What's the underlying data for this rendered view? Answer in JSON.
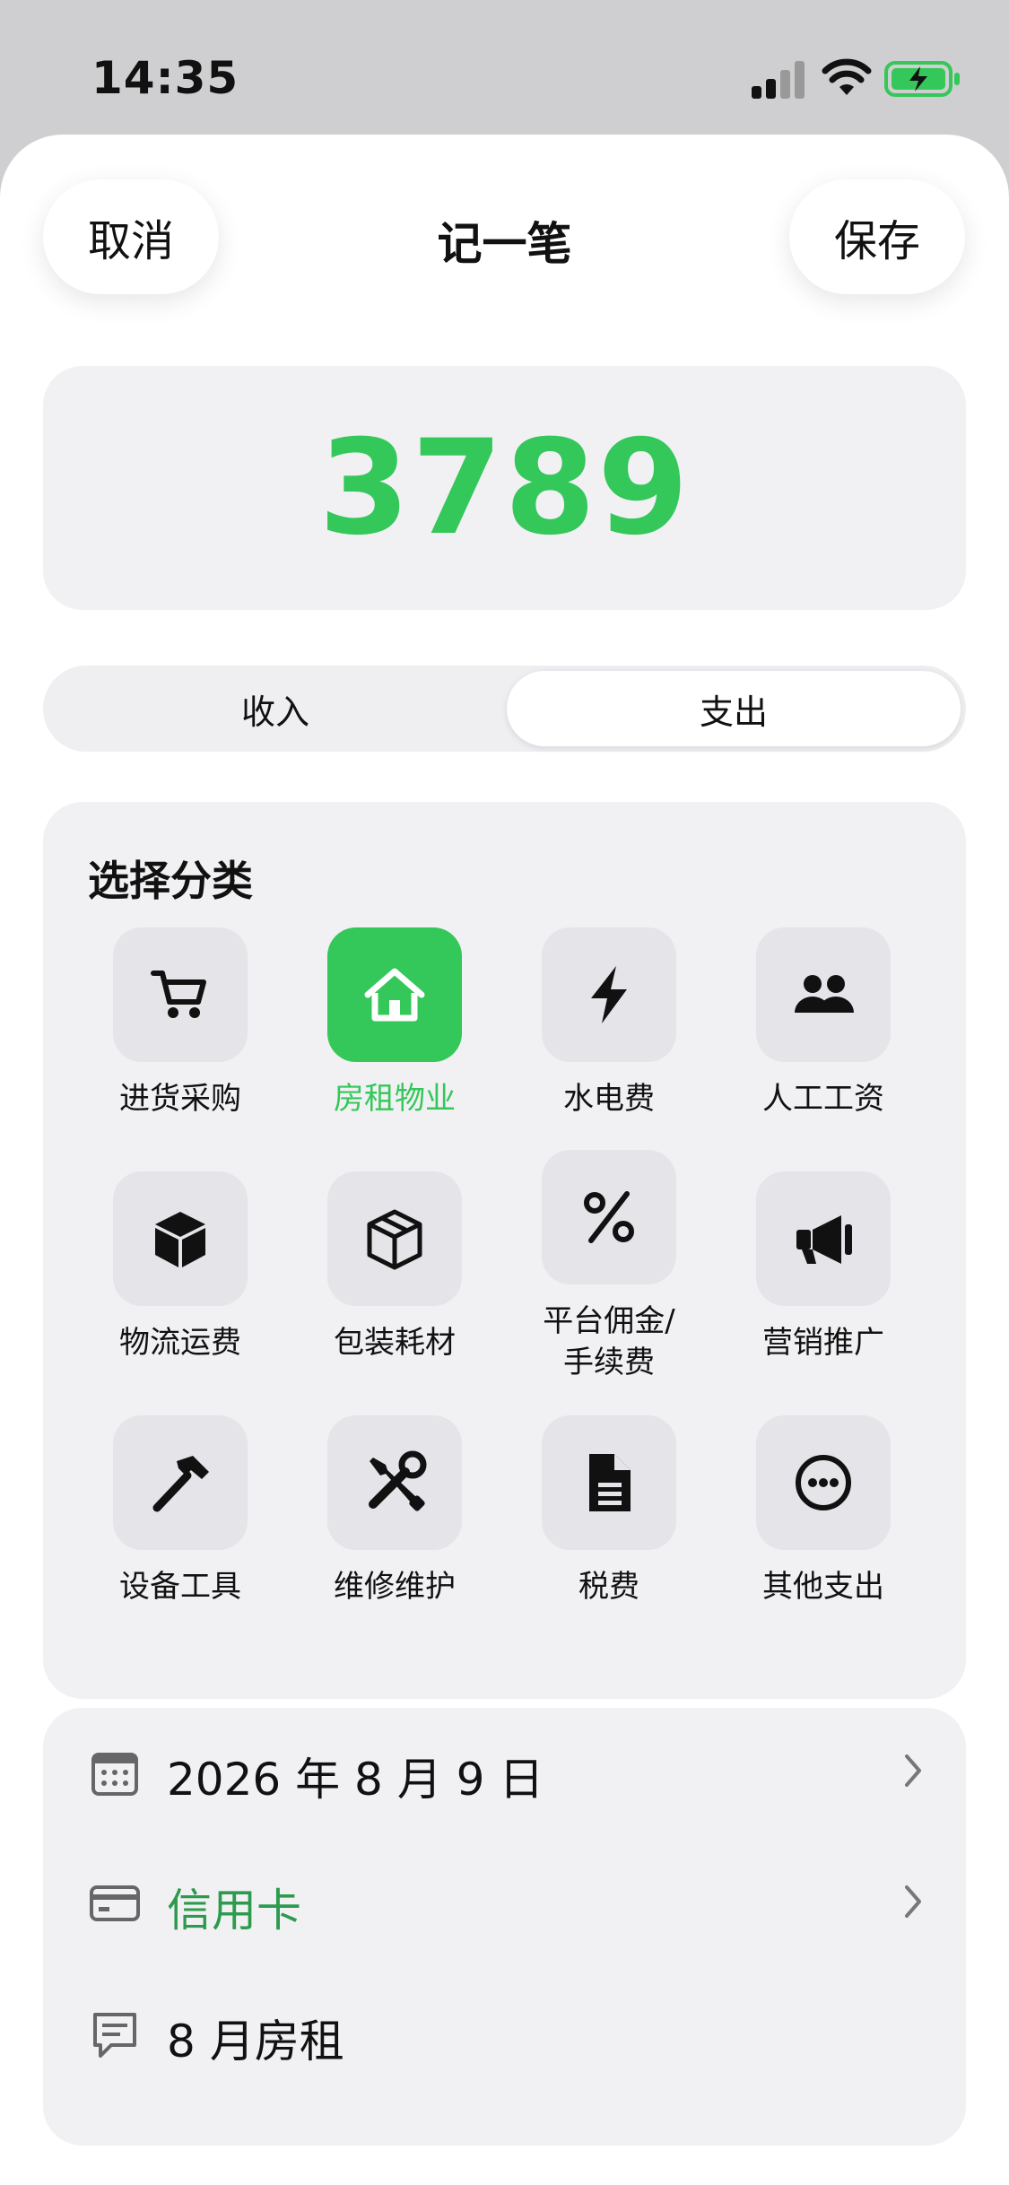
{
  "status_bar": {
    "time": "14:35"
  },
  "header": {
    "cancel": "取消",
    "title": "记一笔",
    "save": "保存"
  },
  "amount": {
    "value": "3789",
    "color": "#34c759"
  },
  "type_toggle": {
    "income": "收入",
    "expense": "支出",
    "selected": "支出"
  },
  "categories": {
    "title": "选择分类",
    "selected": "房租物业",
    "items": [
      {
        "label": "进货采购",
        "icon": "cart-icon"
      },
      {
        "label": "房租物业",
        "icon": "house-icon"
      },
      {
        "label": "水电费",
        "icon": "bolt-icon"
      },
      {
        "label": "人工工资",
        "icon": "people-icon"
      },
      {
        "label": "物流运费",
        "icon": "box-filled-icon"
      },
      {
        "label": "包装耗材",
        "icon": "box-outline-icon"
      },
      {
        "label": "平台佣金/手续费",
        "icon": "percent-icon"
      },
      {
        "label": "营销推广",
        "icon": "megaphone-icon"
      },
      {
        "label": "设备工具",
        "icon": "hammer-icon"
      },
      {
        "label": "维修维护",
        "icon": "tools-icon"
      },
      {
        "label": "税费",
        "icon": "document-icon"
      },
      {
        "label": "其他支出",
        "icon": "more-icon"
      }
    ]
  },
  "details": {
    "date": "2026 年 8 月 9 日",
    "account": "信用卡",
    "note": "8 月房租"
  },
  "colors": {
    "accent": "#34c759",
    "account_text": "#2e9a4e"
  }
}
